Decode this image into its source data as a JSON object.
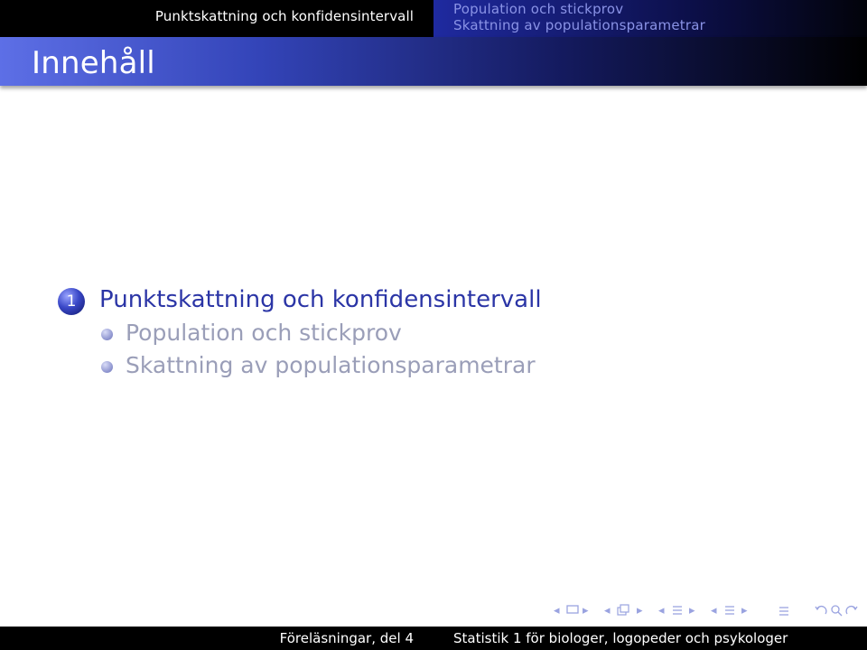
{
  "headline": {
    "section": "Punktskattning och konfidensintervall",
    "subsections": [
      "Population och stickprov",
      "Skattning av populationsparametrar"
    ]
  },
  "frame": {
    "title": "Innehåll"
  },
  "toc": {
    "section": {
      "number": "1",
      "title": "Punktskattning och konfidensintervall"
    },
    "subsections": [
      "Population och stickprov",
      "Skattning av populationsparametrar"
    ]
  },
  "navigation": {
    "icons": [
      "prev-frame-arrow",
      "frame-icon",
      "next-frame-arrow",
      "prev-subsection-arrow",
      "subsection-icon",
      "next-subsection-arrow",
      "prev-section-arrow",
      "section-icon",
      "next-section-arrow",
      "prev-appendix-arrow",
      "document-icon",
      "next-appendix-arrow",
      "align-icon",
      "back-icon",
      "search-icon",
      "forward-icon"
    ]
  },
  "footline": {
    "left": "Föreläsningar, del 4",
    "right": "Statistik 1 för biologer, logopeder och psykologer"
  },
  "colors": {
    "structure": "#2b35a6",
    "subsection_gray": "#9a9eb8",
    "header_bg": "#000000"
  }
}
